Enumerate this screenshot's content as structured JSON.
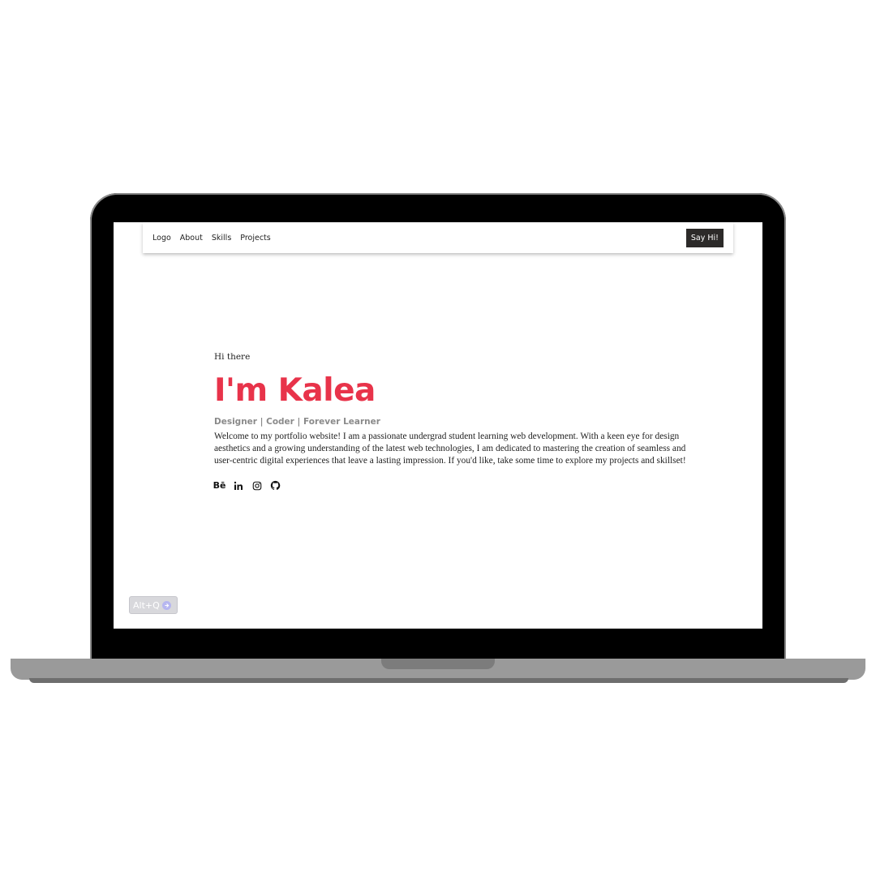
{
  "nav": {
    "logo": "Logo",
    "links": [
      "About",
      "Skills",
      "Projects"
    ],
    "cta": "Say Hi!"
  },
  "hero": {
    "greeting": "Hi there",
    "title": "I'm Kalea",
    "tagline": "Designer | Coder | Forever Learner",
    "intro": "Welcome to my portfolio website! I am a passionate undergrad student learning web development. With a keen eye for design aesthetics and a growing understanding of the latest web technologies, I am dedicated to mastering the creation of seamless and user-centric digital experiences that leave a lasting impression. If you'd like, take some time to explore my projects and skillset!"
  },
  "socials": [
    "behance-icon",
    "linkedin-icon",
    "instagram-icon",
    "github-icon"
  ],
  "behance_glyph": "Bē",
  "shortcut_badge": "Alt+Q",
  "colors": {
    "accent": "#e8334a",
    "button_bg": "#2c2a29",
    "tagline": "#8a8a8a"
  }
}
